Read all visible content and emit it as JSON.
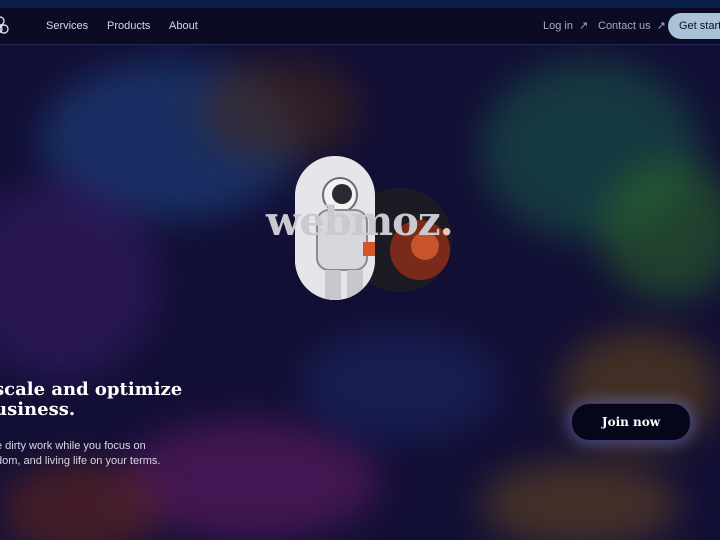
{
  "nav": {
    "items": [
      {
        "label": "Services"
      },
      {
        "label": "Products"
      },
      {
        "label": "About"
      }
    ],
    "login_label": "Log in",
    "contact_label": "Contact us",
    "cta_label": "Get started",
    "arrow_icon": "arrow-up-right-icon",
    "logo_icon": "pretzel-logo-icon"
  },
  "hero": {
    "wordmark": "webmoz",
    "wordmark_dot": ".",
    "headline_line1": "scale and optimize",
    "headline_line2": "usiness.",
    "sub_line1": "e dirty work while you focus on",
    "sub_line2": "dom, and living life on your terms.",
    "join_label": "Join now"
  },
  "colors": {
    "background": "#120f35",
    "nav_background": "#0b0b26",
    "cta_background": "#a9c2d8",
    "join_background": "#06061a"
  }
}
